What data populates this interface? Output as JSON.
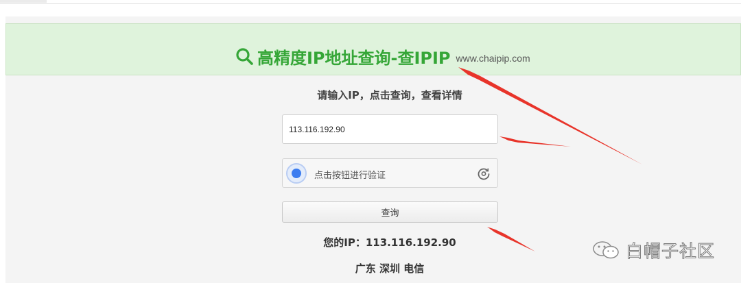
{
  "header": {
    "title": "高精度IP地址查询-查IPIP",
    "domain": "www.chaipip.com"
  },
  "form": {
    "prompt": "请输入IP，点击查询，查看详情",
    "ip_value": "113.116.192.90",
    "captcha_label": "点击按钮进行验证",
    "submit_label": "查询"
  },
  "result": {
    "your_ip": "您的IP：113.116.192.90",
    "location": "广东 深圳 电信"
  },
  "watermark": {
    "text": "白帽子社区"
  },
  "colors": {
    "banner_bg": "#dff3dc",
    "title_green": "#35a637",
    "arrow_red": "#e8342a",
    "captcha_blue": "#3b7cf0"
  },
  "icons": [
    "search-icon",
    "captcha-check-icon",
    "refresh-icon",
    "wechat-icon"
  ]
}
